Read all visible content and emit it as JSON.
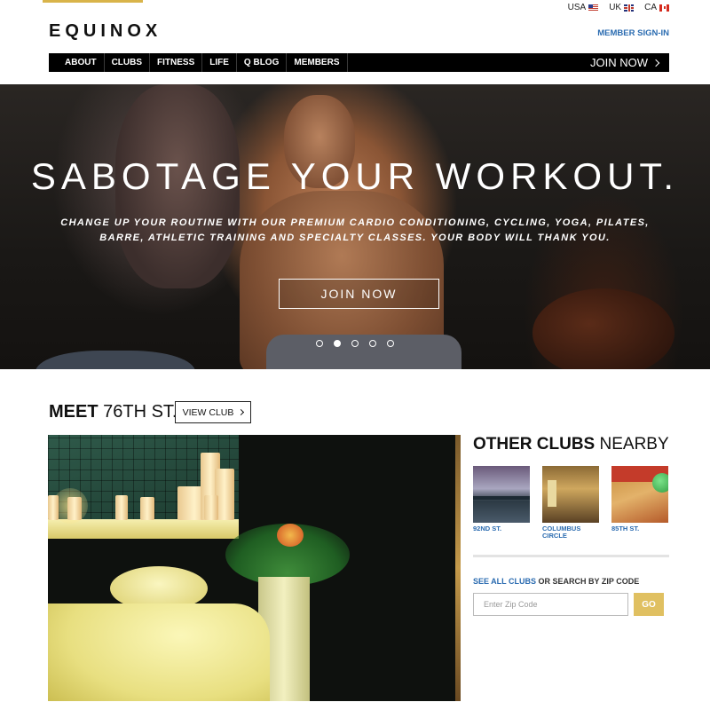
{
  "header": {
    "logo": "EQUINOX",
    "member_signin": "MEMBER SIGN-IN",
    "countries": [
      {
        "label": "USA",
        "flag": "us-flag-icon"
      },
      {
        "label": "UK",
        "flag": "uk-flag-icon"
      },
      {
        "label": "CA",
        "flag": "ca-flag-icon"
      }
    ]
  },
  "nav": {
    "items": [
      "ABOUT",
      "CLUBS",
      "FITNESS",
      "LIFE",
      "Q BLOG",
      "MEMBERS"
    ],
    "join_now": "JOIN NOW"
  },
  "hero": {
    "title": "SABOTAGE YOUR WORKOUT.",
    "subtitle_line1": "CHANGE UP YOUR ROUTINE WITH OUR PREMIUM CARDIO CONDITIONING, CYCLING, YOGA, PILATES,",
    "subtitle_line2": "BARRE, ATHLETIC TRAINING AND SPECIALTY CLASSES. YOUR BODY WILL THANK YOU.",
    "button": "JOIN NOW",
    "slides_total": 5,
    "active_slide": 2
  },
  "meet": {
    "prefix": "MEET",
    "club": "76TH ST.",
    "view_club": "VIEW CLUB"
  },
  "nearby": {
    "heading_bold": "OTHER CLUBS",
    "heading_rest": "NEARBY",
    "clubs": [
      {
        "name_line1": "92ND ST.",
        "name_line2": ""
      },
      {
        "name_line1": "COLUMBUS",
        "name_line2": "CIRCLE"
      },
      {
        "name_line1": "85TH ST.",
        "name_line2": ""
      }
    ]
  },
  "zip": {
    "see_all": "SEE ALL CLUBS",
    "label_rest": "OR SEARCH BY ZIP CODE",
    "placeholder": "Enter Zip Code",
    "button": "GO"
  },
  "colors": {
    "accent_gold": "#d9b44a",
    "link_blue": "#2a6bb0",
    "go_button": "#e0c061",
    "nav_bg": "#000000"
  }
}
